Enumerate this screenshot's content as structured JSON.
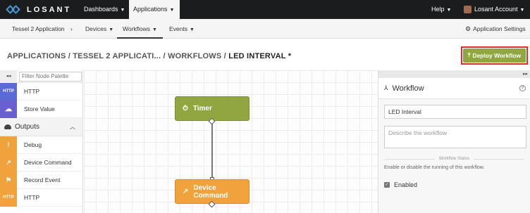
{
  "topnav": {
    "logo_text": "LOSANT",
    "items": [
      {
        "label": "Dashboards"
      },
      {
        "label": "Applications"
      }
    ],
    "help_label": "Help",
    "account_label": "Losant Account"
  },
  "subnav": {
    "app_name": "Tessel 2 Application",
    "app_sep": "›",
    "items": [
      {
        "label": "Devices"
      },
      {
        "label": "Workflows"
      },
      {
        "label": "Events"
      }
    ],
    "settings_label": "Application Settings"
  },
  "breadcrumb": {
    "part1": "APPLICATIONS",
    "part2": "TESSEL 2 APPLICATI...",
    "part3": "WORKFLOWS",
    "current": "LED INTERVAL *",
    "sep": " / "
  },
  "deploy": {
    "label": "Deploy Workflow"
  },
  "palette": {
    "filter_placeholder": "Filter Node Palette",
    "collapse_glyph": "◂◂",
    "top_rows": [
      {
        "label": "HTTP",
        "badge": "HTTP",
        "color": "#5b6bd6"
      },
      {
        "label": "Store Value",
        "badge": "☁",
        "color": "#6a5fd0"
      }
    ],
    "section_label": "Outputs",
    "output_rows": [
      {
        "label": "Debug",
        "badge": "!",
        "color": "#f0a23c"
      },
      {
        "label": "Device Command",
        "badge": "↗",
        "color": "#f0a23c"
      },
      {
        "label": "Record Event",
        "badge": "⚑",
        "color": "#f0a23c"
      },
      {
        "label": "HTTP",
        "badge": "HTTP",
        "color": "#f0a23c"
      }
    ]
  },
  "canvas": {
    "timer_label": "Timer",
    "command_label": "Device Command"
  },
  "panel": {
    "title": "Workflow",
    "name_value": "LED Interval",
    "description_placeholder": "Describe the workflow",
    "status_header": "Workflow Status",
    "status_help": "Enable or disable the running of this workflow.",
    "enabled_label": "Enabled",
    "expand_glyph": "▸▸"
  },
  "colors": {
    "accent_green": "#8fa73e",
    "accent_orange": "#f0a23c",
    "highlight_red": "#d9302b",
    "nav_dark": "#1b1c1e"
  }
}
